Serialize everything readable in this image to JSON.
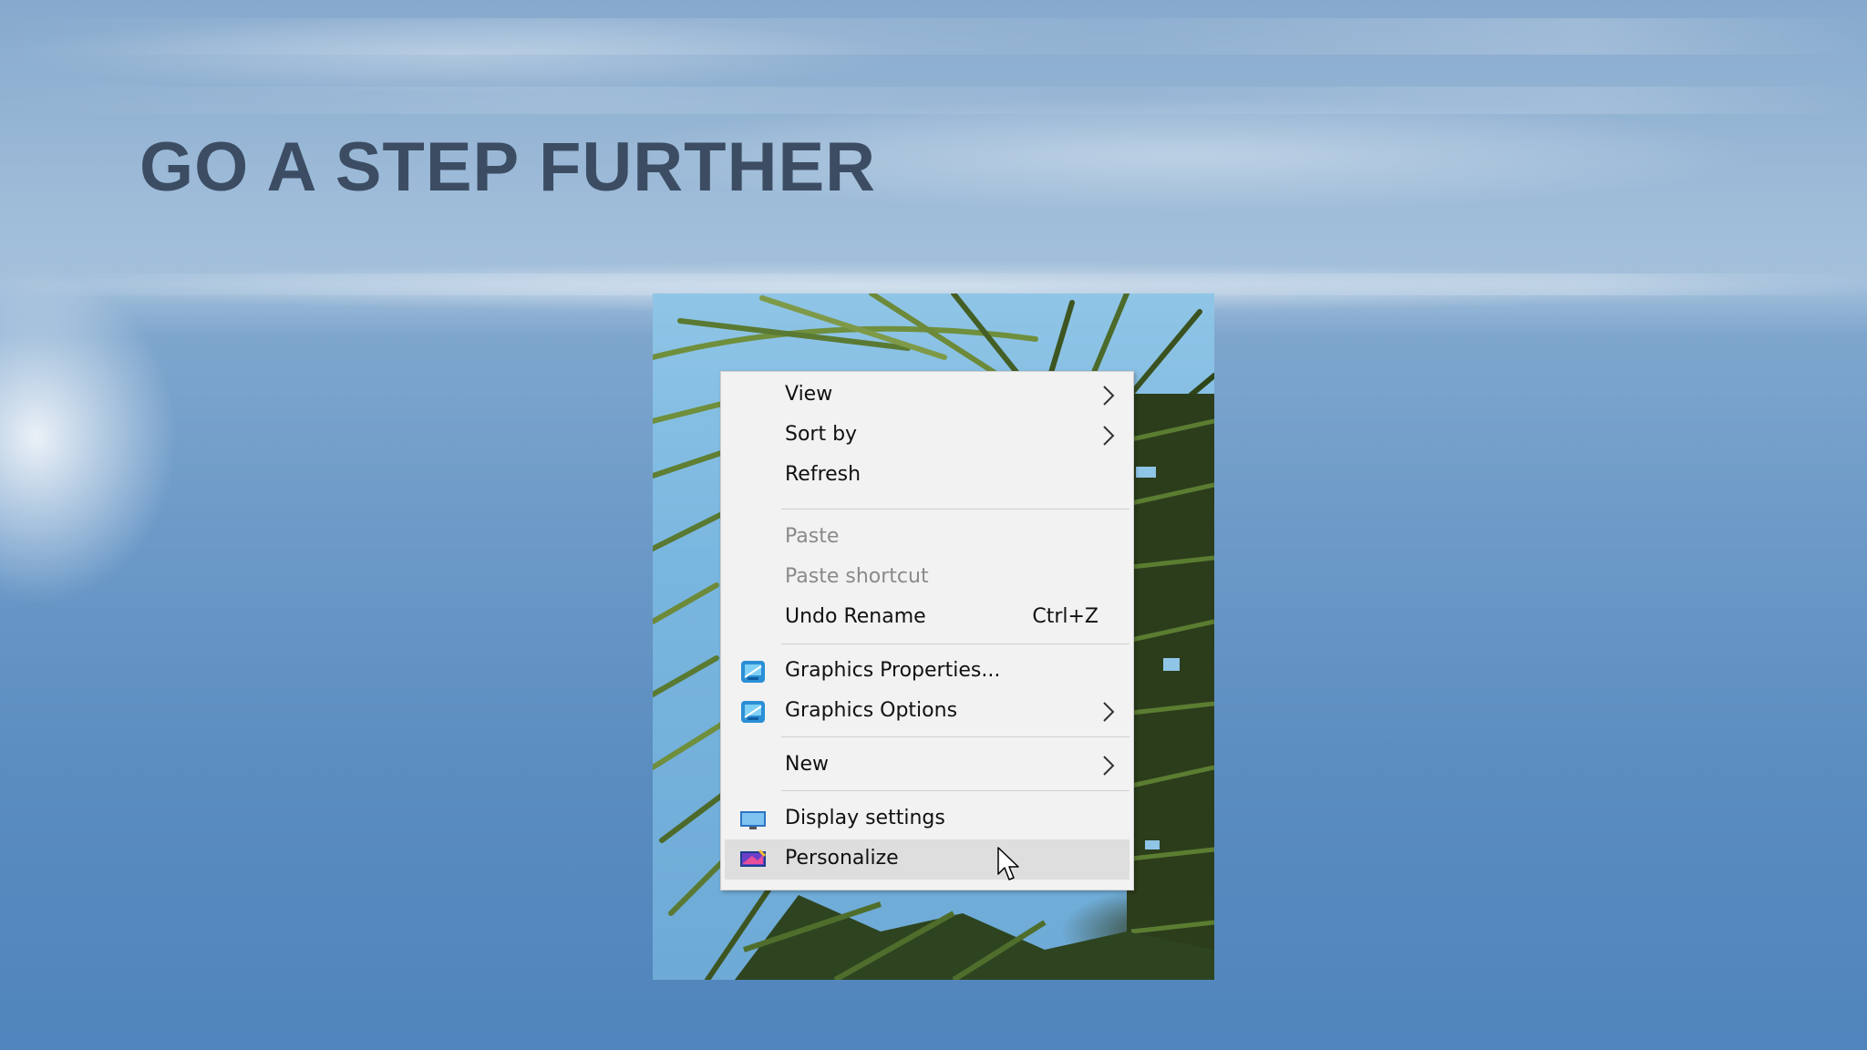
{
  "slide": {
    "title": "GO A STEP FURTHER"
  },
  "context_menu": {
    "items": [
      {
        "label": "View",
        "has_submenu": true,
        "enabled": true
      },
      {
        "label": "Sort by",
        "has_submenu": true,
        "enabled": true
      },
      {
        "label": "Refresh",
        "enabled": true
      },
      {
        "label": "Paste",
        "enabled": false
      },
      {
        "label": "Paste shortcut",
        "enabled": false
      },
      {
        "label": "Undo Rename",
        "shortcut": "Ctrl+Z",
        "enabled": true
      },
      {
        "label": "Graphics Properties...",
        "icon": "graphics-icon",
        "enabled": true
      },
      {
        "label": "Graphics Options",
        "icon": "graphics-icon",
        "has_submenu": true,
        "enabled": true
      },
      {
        "label": "New",
        "has_submenu": true,
        "enabled": true
      },
      {
        "label": "Display settings",
        "icon": "display-icon",
        "enabled": true
      },
      {
        "label": "Personalize",
        "icon": "personalize-icon",
        "enabled": true,
        "highlighted": true
      }
    ]
  },
  "colors": {
    "title": "#3c4d63",
    "menu_background": "#f2f2f2",
    "menu_hover": "#dedede",
    "disabled_text": "#8a8a8a"
  }
}
